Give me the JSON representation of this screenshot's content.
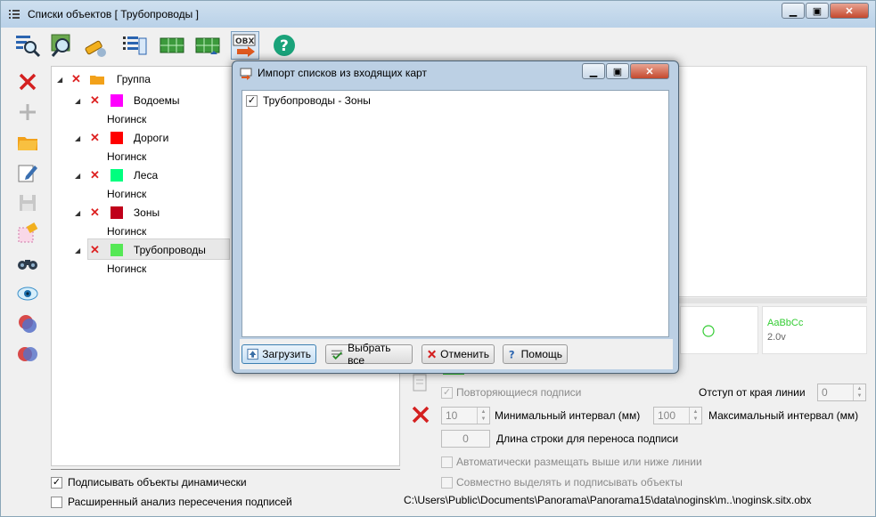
{
  "window": {
    "title": "Списки объектов  [ Трубопроводы ]"
  },
  "tree": {
    "root_label": "Группа",
    "items": [
      {
        "label": "Водоемы",
        "color": "#ff00ff",
        "child": "Ногинск"
      },
      {
        "label": "Дороги",
        "color": "#ff0000",
        "child": "Ногинск"
      },
      {
        "label": "Леса",
        "color": "#00ff7f",
        "child": "Ногинск"
      },
      {
        "label": "Зоны",
        "color": "#c0001a",
        "child": "Ногинск"
      },
      {
        "label": "Трубопроводы",
        "color": "#55e855",
        "child": "Ногинск"
      }
    ]
  },
  "options": {
    "dynamic_labels": "Подписывать объекты динамически",
    "extended_analysis": "Расширенный анализ пересечения подписей"
  },
  "preview": {
    "sample_text": "AaBbCc",
    "sample_size": "2.0v"
  },
  "settings": {
    "repeat_labels": "Повторяющиеся подписи",
    "edge_offset_label": "Отступ от края линии",
    "edge_offset_value": "0",
    "min_interval_value": "10",
    "min_interval_label": "Минимальный интервал (мм)",
    "max_interval_value": "100",
    "max_interval_label": "Максимальный интервал (мм)",
    "wrap_value": "0",
    "wrap_label": "Длина строки для переноса подписи",
    "auto_place": "Автоматически размещать выше или ниже линии",
    "joint_select": "Совместно выделять и подписывать объекты"
  },
  "path": "C:\\Users\\Public\\Documents\\Panorama\\Panorama15\\data\\noginsk\\m..\\noginsk.sitx.obx",
  "dialog": {
    "title": "Импорт списков из входящих карт",
    "list_item": "Трубопроводы - Зоны",
    "btn_load": "Загрузить",
    "btn_select_all": "Выбрать все",
    "btn_cancel": "Отменить",
    "btn_help": "Помощь"
  },
  "toolbar_icons": [
    "find-list-icon",
    "search-map-icon",
    "flashlight-icon",
    "list-settings-icon",
    "green-grid-icon",
    "green-grid-2-icon",
    "obx-export-icon",
    "help-icon"
  ]
}
